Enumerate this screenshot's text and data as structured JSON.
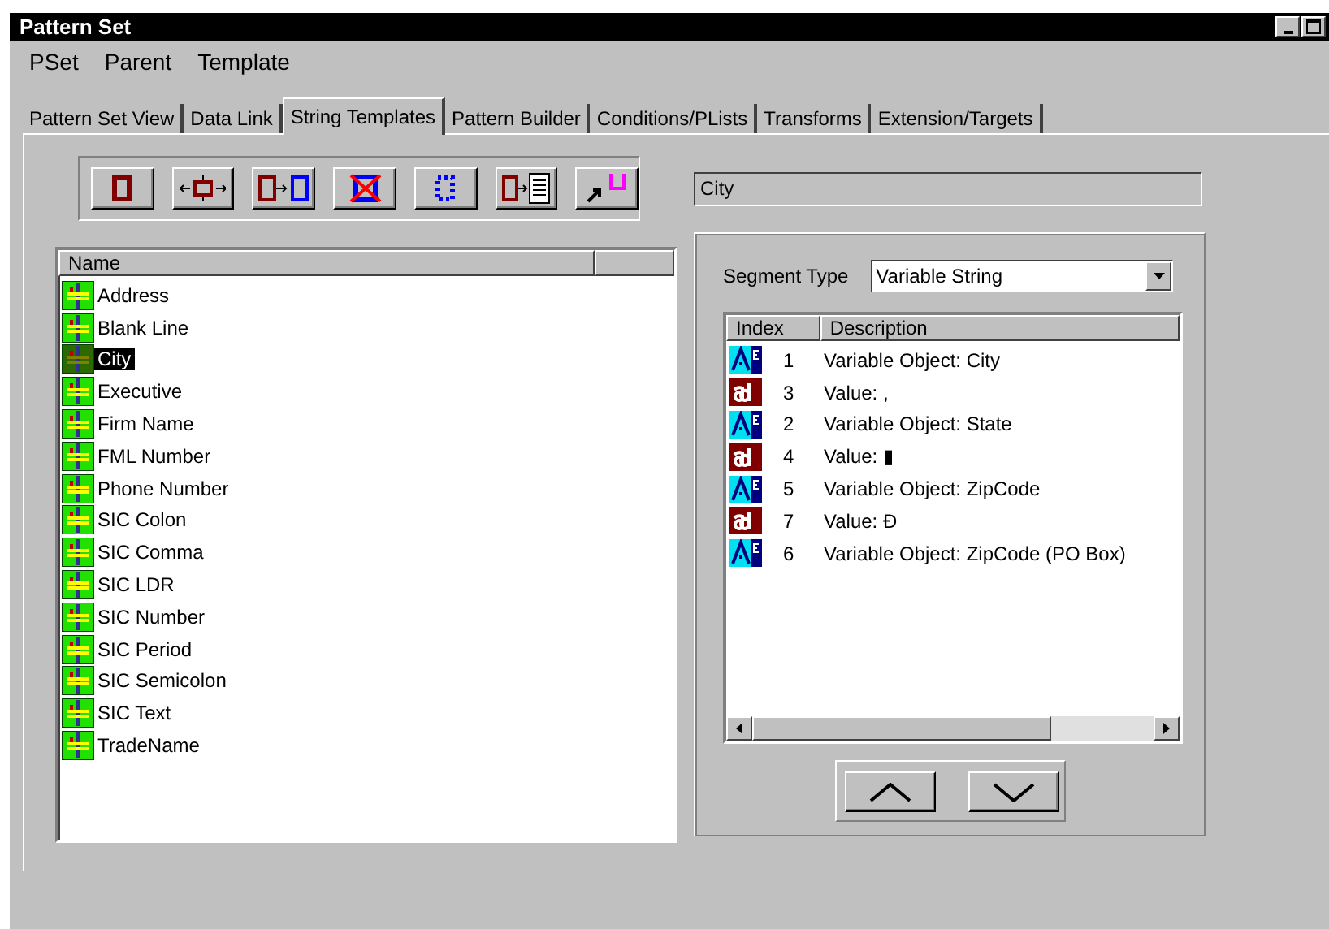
{
  "window": {
    "title": "Pattern Set"
  },
  "menu": [
    "PSet",
    "Parent",
    "Template"
  ],
  "tabs": [
    {
      "label": "Pattern Set View",
      "selected": false
    },
    {
      "label": "Data Link",
      "selected": false
    },
    {
      "label": "String Templates",
      "selected": true
    },
    {
      "label": "Pattern Builder",
      "selected": false
    },
    {
      "label": "Conditions/PLists",
      "selected": false
    },
    {
      "label": "Transforms",
      "selected": false
    },
    {
      "label": "Extension/Targets",
      "selected": false
    }
  ],
  "template_name": {
    "value": "City"
  },
  "templates": {
    "columns": [
      "Name"
    ],
    "items": [
      {
        "label": "Address",
        "selected": false
      },
      {
        "label": "Blank Line",
        "selected": false
      },
      {
        "label": "City",
        "selected": true
      },
      {
        "label": "Executive",
        "selected": false
      },
      {
        "label": "Firm Name",
        "selected": false
      },
      {
        "label": "FML Number",
        "selected": false
      },
      {
        "label": "Phone Number",
        "selected": false
      },
      {
        "label": "SIC Colon",
        "selected": false
      },
      {
        "label": "SIC Comma",
        "selected": false
      },
      {
        "label": "SIC LDR",
        "selected": false
      },
      {
        "label": "SIC Number",
        "selected": false
      },
      {
        "label": "SIC Period",
        "selected": false
      },
      {
        "label": "SIC Semicolon",
        "selected": false
      },
      {
        "label": "SIC Text",
        "selected": false
      },
      {
        "label": "TradeName",
        "selected": false
      }
    ]
  },
  "segment_type": {
    "label": "Segment Type",
    "value": "Variable String"
  },
  "segments": {
    "columns": [
      "Index",
      "Description"
    ],
    "rows": [
      {
        "kind": "variable",
        "index": "1",
        "description": "Variable Object: City"
      },
      {
        "kind": "value",
        "index": "3",
        "description": "Value: ,"
      },
      {
        "kind": "variable",
        "index": "2",
        "description": "Variable Object: State"
      },
      {
        "kind": "value",
        "index": "4",
        "description": "Value: ▮"
      },
      {
        "kind": "variable",
        "index": "5",
        "description": "Variable Object: ZipCode"
      },
      {
        "kind": "value",
        "index": "7",
        "description": "Value: Đ"
      },
      {
        "kind": "variable",
        "index": "6",
        "description": "Variable Object: ZipCode (PO Box)"
      }
    ]
  }
}
